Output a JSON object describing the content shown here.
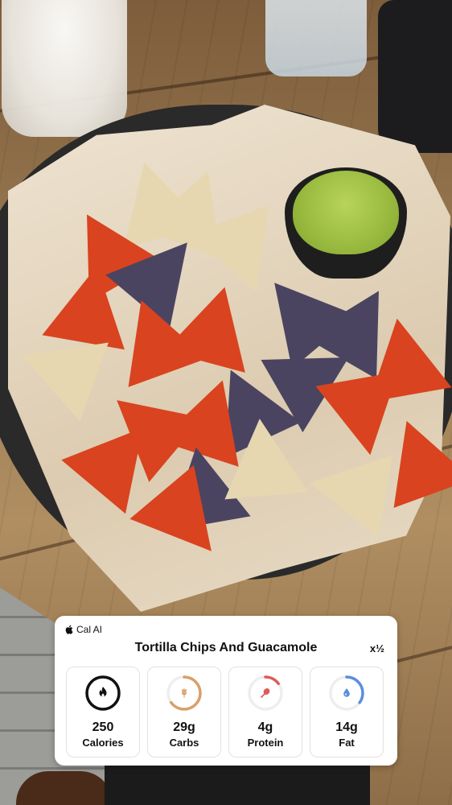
{
  "brand": {
    "name": "Cal AI",
    "icon": "apple-icon"
  },
  "meal": {
    "title": "Tortilla Chips And Guacamole",
    "serving": "x½"
  },
  "colors": {
    "calories": "#111111",
    "carbs": "#d9a06a",
    "protein": "#e05a5a",
    "fat": "#5a8fe0",
    "track": "#eeeeee"
  },
  "nutrients": [
    {
      "value": "250",
      "label": "Calories",
      "icon": "flame-icon",
      "progress": 1.0
    },
    {
      "value": "29g",
      "label": "Carbs",
      "icon": "wheat-icon",
      "progress": 0.65
    },
    {
      "value": "4g",
      "label": "Protein",
      "icon": "drumstick-icon",
      "progress": 0.15
    },
    {
      "value": "14g",
      "label": "Fat",
      "icon": "droplet-icon",
      "progress": 0.35
    }
  ]
}
